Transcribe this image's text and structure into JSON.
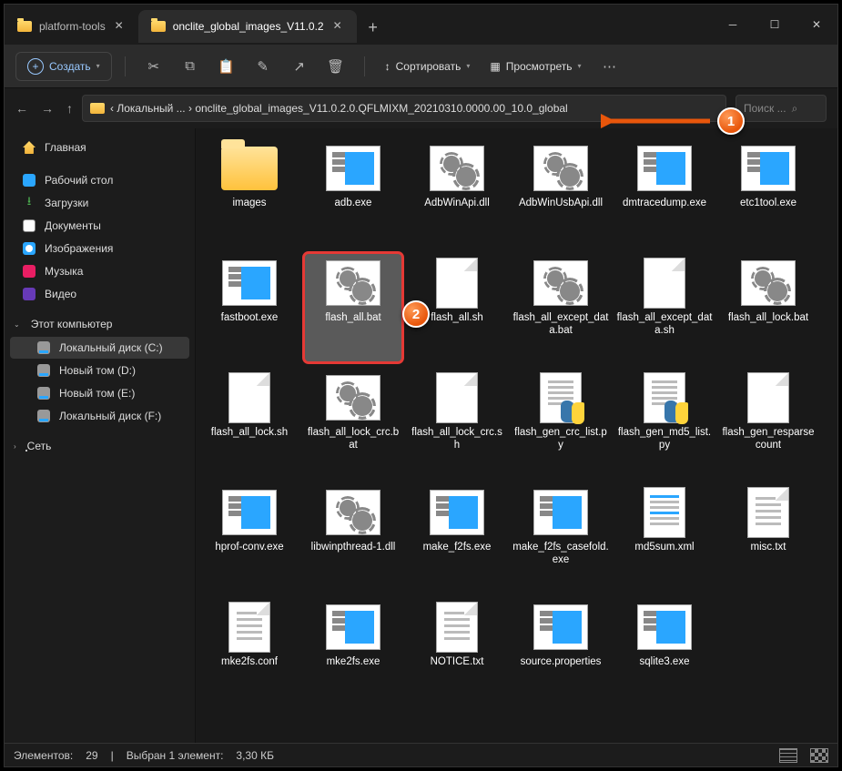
{
  "tabs": [
    {
      "label": "platform-tools",
      "active": false
    },
    {
      "label": "onclite_global_images_V11.0.2",
      "active": true
    }
  ],
  "toolbar": {
    "create": "Создать",
    "sort": "Сортировать",
    "view": "Просмотреть"
  },
  "breadcrumb": {
    "part1": "Локальный ...",
    "part2": "onclite_global_images_V11.0.2.0.QFLMIXM_20210310.0000.00_10.0_global",
    "sep": "›",
    "lead": "‹"
  },
  "search": {
    "placeholder": "Поиск ..."
  },
  "sidebar": {
    "home": "Главная",
    "desktop": "Рабочий стол",
    "downloads": "Загрузки",
    "documents": "Документы",
    "pictures": "Изображения",
    "music": "Музыка",
    "video": "Видео",
    "thispc": "Этот компьютер",
    "drives": [
      "Локальный диск (C:)",
      "Новый том (D:)",
      "Новый том (E:)",
      "Локальный диск (F:)"
    ],
    "network": "Сеть"
  },
  "files": [
    {
      "name": "images",
      "type": "folder"
    },
    {
      "name": "adb.exe",
      "type": "exe"
    },
    {
      "name": "AdbWinApi.dll",
      "type": "dll"
    },
    {
      "name": "AdbWinUsbApi.dll",
      "type": "dll"
    },
    {
      "name": "dmtracedump.exe",
      "type": "exe"
    },
    {
      "name": "etc1tool.exe",
      "type": "exe"
    },
    {
      "name": "fastboot.exe",
      "type": "exe"
    },
    {
      "name": "flash_all.bat",
      "type": "bat",
      "selected": true,
      "highlighted": true
    },
    {
      "name": "flash_all.sh",
      "type": "sh"
    },
    {
      "name": "flash_all_except_data.bat",
      "type": "bat"
    },
    {
      "name": "flash_all_except_data.sh",
      "type": "sh"
    },
    {
      "name": "flash_all_lock.bat",
      "type": "bat"
    },
    {
      "name": "flash_all_lock.sh",
      "type": "sh"
    },
    {
      "name": "flash_all_lock_crc.bat",
      "type": "bat"
    },
    {
      "name": "flash_all_lock_crc.sh",
      "type": "sh"
    },
    {
      "name": "flash_gen_crc_list.py",
      "type": "py"
    },
    {
      "name": "flash_gen_md5_list.py",
      "type": "py"
    },
    {
      "name": "flash_gen_resparsecount",
      "type": "blank"
    },
    {
      "name": "hprof-conv.exe",
      "type": "exe"
    },
    {
      "name": "libwinpthread-1.dll",
      "type": "dll"
    },
    {
      "name": "make_f2fs.exe",
      "type": "exe"
    },
    {
      "name": "make_f2fs_casefold.exe",
      "type": "exe"
    },
    {
      "name": "md5sum.xml",
      "type": "xml"
    },
    {
      "name": "misc.txt",
      "type": "txt"
    },
    {
      "name": "mke2fs.conf",
      "type": "txt"
    },
    {
      "name": "mke2fs.exe",
      "type": "exe"
    },
    {
      "name": "NOTICE.txt",
      "type": "txt"
    },
    {
      "name": "source.properties",
      "type": "prop"
    },
    {
      "name": "sqlite3.exe",
      "type": "exe"
    }
  ],
  "status": {
    "count_label": "Элементов:",
    "count": "29",
    "sel_label": "Выбран 1 элемент:",
    "sel_size": "3,30 КБ"
  },
  "markers": {
    "m1": "1",
    "m2": "2"
  }
}
